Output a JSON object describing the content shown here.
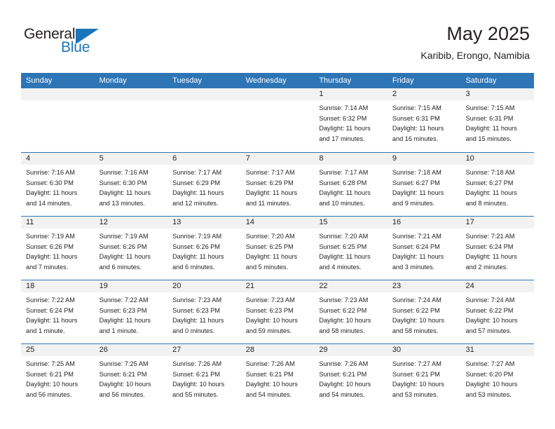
{
  "logo": {
    "text_top": "General",
    "text_bottom": "Blue",
    "triangle_icon": "logo-triangle-icon",
    "color_dark": "#231f20",
    "color_blue": "#1b75bb"
  },
  "header": {
    "title": "May 2025",
    "subtitle": "Karibib, Erongo, Namibia"
  },
  "colors": {
    "header_bar": "#2e75b6",
    "day_number_band": "#f2f2f2",
    "text": "#231f20",
    "white": "#ffffff"
  },
  "weekdays": [
    "Sunday",
    "Monday",
    "Tuesday",
    "Wednesday",
    "Thursday",
    "Friday",
    "Saturday"
  ],
  "weeks": [
    [
      {
        "day": "",
        "empty": true,
        "sunrise": "",
        "sunset": "",
        "daylight_line1": "",
        "daylight_line2": ""
      },
      {
        "day": "",
        "empty": true,
        "sunrise": "",
        "sunset": "",
        "daylight_line1": "",
        "daylight_line2": ""
      },
      {
        "day": "",
        "empty": true,
        "sunrise": "",
        "sunset": "",
        "daylight_line1": "",
        "daylight_line2": ""
      },
      {
        "day": "",
        "empty": true,
        "sunrise": "",
        "sunset": "",
        "daylight_line1": "",
        "daylight_line2": ""
      },
      {
        "day": "1",
        "empty": false,
        "sunrise": "Sunrise: 7:14 AM",
        "sunset": "Sunset: 6:32 PM",
        "daylight_line1": "Daylight: 11 hours",
        "daylight_line2": "and 17 minutes."
      },
      {
        "day": "2",
        "empty": false,
        "sunrise": "Sunrise: 7:15 AM",
        "sunset": "Sunset: 6:31 PM",
        "daylight_line1": "Daylight: 11 hours",
        "daylight_line2": "and 16 minutes."
      },
      {
        "day": "3",
        "empty": false,
        "sunrise": "Sunrise: 7:15 AM",
        "sunset": "Sunset: 6:31 PM",
        "daylight_line1": "Daylight: 11 hours",
        "daylight_line2": "and 15 minutes."
      }
    ],
    [
      {
        "day": "4",
        "empty": false,
        "sunrise": "Sunrise: 7:16 AM",
        "sunset": "Sunset: 6:30 PM",
        "daylight_line1": "Daylight: 11 hours",
        "daylight_line2": "and 14 minutes."
      },
      {
        "day": "5",
        "empty": false,
        "sunrise": "Sunrise: 7:16 AM",
        "sunset": "Sunset: 6:30 PM",
        "daylight_line1": "Daylight: 11 hours",
        "daylight_line2": "and 13 minutes."
      },
      {
        "day": "6",
        "empty": false,
        "sunrise": "Sunrise: 7:17 AM",
        "sunset": "Sunset: 6:29 PM",
        "daylight_line1": "Daylight: 11 hours",
        "daylight_line2": "and 12 minutes."
      },
      {
        "day": "7",
        "empty": false,
        "sunrise": "Sunrise: 7:17 AM",
        "sunset": "Sunset: 6:29 PM",
        "daylight_line1": "Daylight: 11 hours",
        "daylight_line2": "and 11 minutes."
      },
      {
        "day": "8",
        "empty": false,
        "sunrise": "Sunrise: 7:17 AM",
        "sunset": "Sunset: 6:28 PM",
        "daylight_line1": "Daylight: 11 hours",
        "daylight_line2": "and 10 minutes."
      },
      {
        "day": "9",
        "empty": false,
        "sunrise": "Sunrise: 7:18 AM",
        "sunset": "Sunset: 6:27 PM",
        "daylight_line1": "Daylight: 11 hours",
        "daylight_line2": "and 9 minutes."
      },
      {
        "day": "10",
        "empty": false,
        "sunrise": "Sunrise: 7:18 AM",
        "sunset": "Sunset: 6:27 PM",
        "daylight_line1": "Daylight: 11 hours",
        "daylight_line2": "and 8 minutes."
      }
    ],
    [
      {
        "day": "11",
        "empty": false,
        "sunrise": "Sunrise: 7:19 AM",
        "sunset": "Sunset: 6:26 PM",
        "daylight_line1": "Daylight: 11 hours",
        "daylight_line2": "and 7 minutes."
      },
      {
        "day": "12",
        "empty": false,
        "sunrise": "Sunrise: 7:19 AM",
        "sunset": "Sunset: 6:26 PM",
        "daylight_line1": "Daylight: 11 hours",
        "daylight_line2": "and 6 minutes."
      },
      {
        "day": "13",
        "empty": false,
        "sunrise": "Sunrise: 7:19 AM",
        "sunset": "Sunset: 6:26 PM",
        "daylight_line1": "Daylight: 11 hours",
        "daylight_line2": "and 6 minutes."
      },
      {
        "day": "14",
        "empty": false,
        "sunrise": "Sunrise: 7:20 AM",
        "sunset": "Sunset: 6:25 PM",
        "daylight_line1": "Daylight: 11 hours",
        "daylight_line2": "and 5 minutes."
      },
      {
        "day": "15",
        "empty": false,
        "sunrise": "Sunrise: 7:20 AM",
        "sunset": "Sunset: 6:25 PM",
        "daylight_line1": "Daylight: 11 hours",
        "daylight_line2": "and 4 minutes."
      },
      {
        "day": "16",
        "empty": false,
        "sunrise": "Sunrise: 7:21 AM",
        "sunset": "Sunset: 6:24 PM",
        "daylight_line1": "Daylight: 11 hours",
        "daylight_line2": "and 3 minutes."
      },
      {
        "day": "17",
        "empty": false,
        "sunrise": "Sunrise: 7:21 AM",
        "sunset": "Sunset: 6:24 PM",
        "daylight_line1": "Daylight: 11 hours",
        "daylight_line2": "and 2 minutes."
      }
    ],
    [
      {
        "day": "18",
        "empty": false,
        "sunrise": "Sunrise: 7:22 AM",
        "sunset": "Sunset: 6:24 PM",
        "daylight_line1": "Daylight: 11 hours",
        "daylight_line2": "and 1 minute."
      },
      {
        "day": "19",
        "empty": false,
        "sunrise": "Sunrise: 7:22 AM",
        "sunset": "Sunset: 6:23 PM",
        "daylight_line1": "Daylight: 11 hours",
        "daylight_line2": "and 1 minute."
      },
      {
        "day": "20",
        "empty": false,
        "sunrise": "Sunrise: 7:23 AM",
        "sunset": "Sunset: 6:23 PM",
        "daylight_line1": "Daylight: 11 hours",
        "daylight_line2": "and 0 minutes."
      },
      {
        "day": "21",
        "empty": false,
        "sunrise": "Sunrise: 7:23 AM",
        "sunset": "Sunset: 6:23 PM",
        "daylight_line1": "Daylight: 10 hours",
        "daylight_line2": "and 59 minutes."
      },
      {
        "day": "22",
        "empty": false,
        "sunrise": "Sunrise: 7:23 AM",
        "sunset": "Sunset: 6:22 PM",
        "daylight_line1": "Daylight: 10 hours",
        "daylight_line2": "and 58 minutes."
      },
      {
        "day": "23",
        "empty": false,
        "sunrise": "Sunrise: 7:24 AM",
        "sunset": "Sunset: 6:22 PM",
        "daylight_line1": "Daylight: 10 hours",
        "daylight_line2": "and 58 minutes."
      },
      {
        "day": "24",
        "empty": false,
        "sunrise": "Sunrise: 7:24 AM",
        "sunset": "Sunset: 6:22 PM",
        "daylight_line1": "Daylight: 10 hours",
        "daylight_line2": "and 57 minutes."
      }
    ],
    [
      {
        "day": "25",
        "empty": false,
        "sunrise": "Sunrise: 7:25 AM",
        "sunset": "Sunset: 6:21 PM",
        "daylight_line1": "Daylight: 10 hours",
        "daylight_line2": "and 56 minutes."
      },
      {
        "day": "26",
        "empty": false,
        "sunrise": "Sunrise: 7:25 AM",
        "sunset": "Sunset: 6:21 PM",
        "daylight_line1": "Daylight: 10 hours",
        "daylight_line2": "and 56 minutes."
      },
      {
        "day": "27",
        "empty": false,
        "sunrise": "Sunrise: 7:26 AM",
        "sunset": "Sunset: 6:21 PM",
        "daylight_line1": "Daylight: 10 hours",
        "daylight_line2": "and 55 minutes."
      },
      {
        "day": "28",
        "empty": false,
        "sunrise": "Sunrise: 7:26 AM",
        "sunset": "Sunset: 6:21 PM",
        "daylight_line1": "Daylight: 10 hours",
        "daylight_line2": "and 54 minutes."
      },
      {
        "day": "29",
        "empty": false,
        "sunrise": "Sunrise: 7:26 AM",
        "sunset": "Sunset: 6:21 PM",
        "daylight_line1": "Daylight: 10 hours",
        "daylight_line2": "and 54 minutes."
      },
      {
        "day": "30",
        "empty": false,
        "sunrise": "Sunrise: 7:27 AM",
        "sunset": "Sunset: 6:21 PM",
        "daylight_line1": "Daylight: 10 hours",
        "daylight_line2": "and 53 minutes."
      },
      {
        "day": "31",
        "empty": false,
        "sunrise": "Sunrise: 7:27 AM",
        "sunset": "Sunset: 6:20 PM",
        "daylight_line1": "Daylight: 10 hours",
        "daylight_line2": "and 53 minutes."
      }
    ]
  ]
}
